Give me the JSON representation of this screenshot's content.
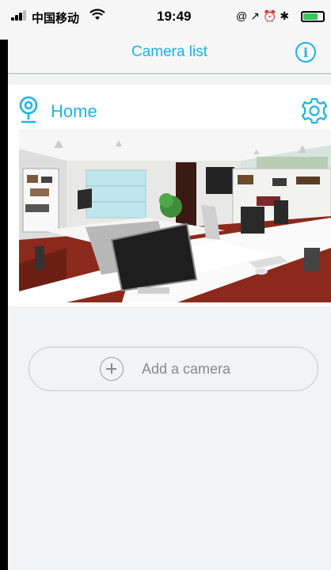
{
  "status_bar": {
    "carrier": "中国移动",
    "time": "19:49",
    "wifi_icon": "wifi-icon",
    "indicator_icons": [
      "orientation-lock-icon",
      "location-icon",
      "alarm-icon",
      "bluetooth-icon"
    ],
    "indicator_glyphs": "@↗⏰✱",
    "battery_icon": "battery-icon",
    "battery_color": "#34c759"
  },
  "navbar": {
    "title": "Camera list",
    "info_icon": "info-icon",
    "info_glyph": "i"
  },
  "cameras": [
    {
      "name": "Home",
      "status_icon": "webcam-icon",
      "settings_icon": "gear-icon",
      "preview": "office-scene-preview"
    }
  ],
  "add_camera": {
    "label": "Add a camera",
    "icon": "plus-circle-icon"
  },
  "colors": {
    "accent": "#1ab3e6",
    "background": "#f2f3f4",
    "muted_text": "#8a8a8a"
  }
}
